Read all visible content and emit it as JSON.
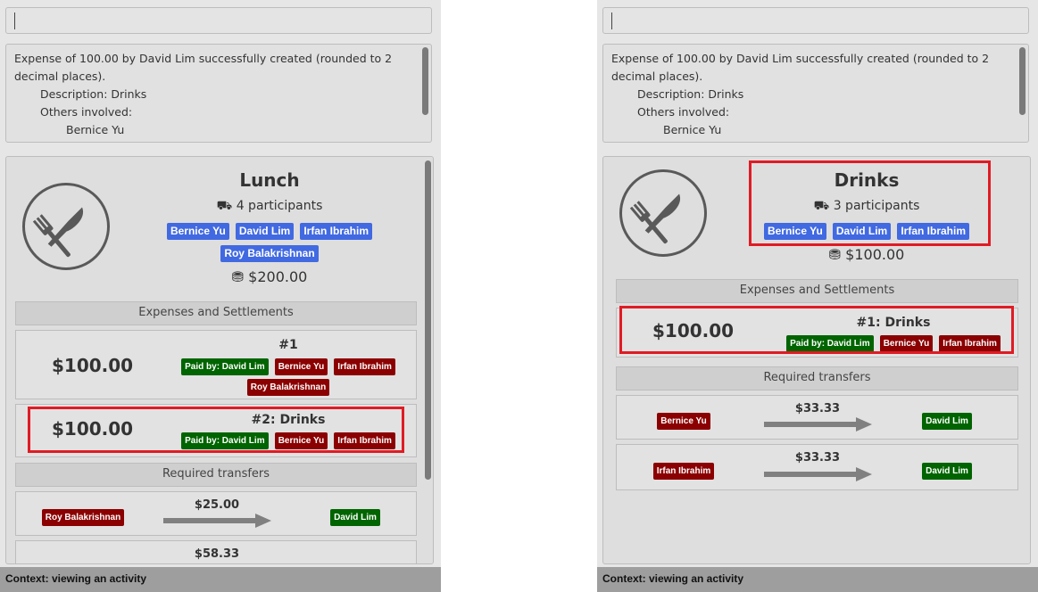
{
  "command_box": {
    "value": ""
  },
  "result": {
    "line1": "Expense of 100.00 by David Lim successfully created (rounded to 2 decimal places).",
    "description": "Description: Drinks",
    "others_label": "Others involved:",
    "others": [
      "Bernice Yu"
    ]
  },
  "left": {
    "activity": {
      "title": "Lunch",
      "participants_text": "4 participants",
      "participants": [
        "Bernice Yu",
        "David Lim",
        "Irfan Ibrahim",
        "Roy Balakrishnan"
      ],
      "total": "$200.00"
    },
    "expenses_header": "Expenses and Settlements",
    "expenses": [
      {
        "title": "#1",
        "amount": "$100.00",
        "payer": "Paid by: David Lim",
        "involved": [
          "Bernice Yu",
          "Irfan Ibrahim",
          "Roy Balakrishnan"
        ]
      },
      {
        "title": "#2: Drinks",
        "amount": "$100.00",
        "payer": "Paid by: David Lim",
        "involved": [
          "Bernice Yu",
          "Irfan Ibrahim"
        ]
      }
    ],
    "transfers_header": "Required transfers",
    "transfers": [
      {
        "from": "Roy Balakrishnan",
        "amount": "$25.00",
        "to": "David Lim"
      },
      {
        "from": "",
        "amount": "$58.33",
        "to": ""
      }
    ],
    "status": "Context: viewing an activity"
  },
  "right": {
    "activity": {
      "title": "Drinks",
      "participants_text": "3 participants",
      "participants": [
        "Bernice Yu",
        "David Lim",
        "Irfan Ibrahim"
      ],
      "total": "$100.00"
    },
    "expenses_header": "Expenses and Settlements",
    "expenses": [
      {
        "title": "#1: Drinks",
        "amount": "$100.00",
        "payer": "Paid by: David Lim",
        "involved": [
          "Bernice Yu",
          "Irfan Ibrahim"
        ]
      }
    ],
    "transfers_header": "Required transfers",
    "transfers": [
      {
        "from": "Bernice Yu",
        "amount": "$33.33",
        "to": "David Lim"
      },
      {
        "from": "Irfan Ibrahim",
        "amount": "$33.33",
        "to": "David Lim"
      }
    ],
    "status": "Context: viewing an activity"
  },
  "icons": {
    "activity": "fork-knife-icon",
    "participants": "people-icon",
    "money": "coins-icon"
  },
  "colors": {
    "participant_tag": "#4169e1",
    "payer_tag": "#006400",
    "involved_tag": "#8b0000",
    "highlight": "#e01b24"
  }
}
